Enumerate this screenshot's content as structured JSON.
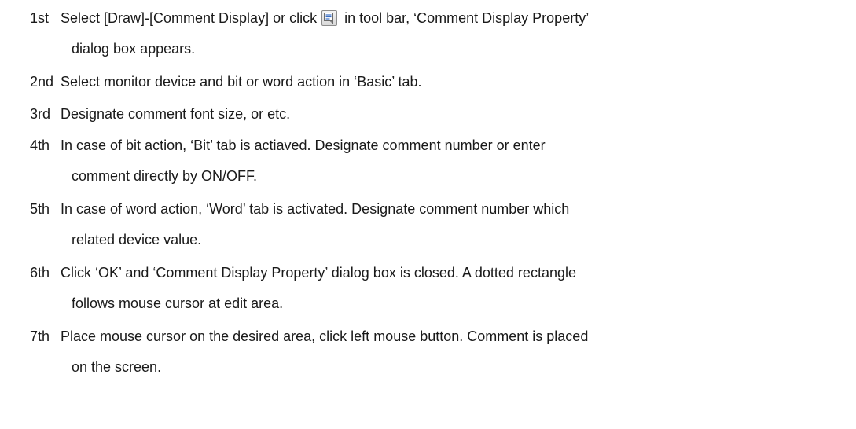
{
  "steps": [
    {
      "number": "1st",
      "text_before_icon": "Select [Draw]-[Comment Display] or click",
      "icon": "comment-display-icon",
      "text_after_icon": "in tool bar, ‘Comment Display Property’",
      "continuation": "dialog box appears."
    },
    {
      "number": "2nd",
      "text": "Select monitor device and bit or word action in ‘Basic’ tab."
    },
    {
      "number": "3rd",
      "text": "Designate comment font size, or etc."
    },
    {
      "number": "4th",
      "text": "In case of bit action, ‘Bit’ tab is actiaved. Designate comment number or enter",
      "continuation": "comment directly by ON/OFF."
    },
    {
      "number": "5th",
      "text": "In case of word action, ‘Word’ tab is activated. Designate comment number which",
      "continuation": "related device value."
    },
    {
      "number": "6th",
      "text": "Click ‘OK’ and ‘Comment Display Property’ dialog box is closed. A dotted rectangle",
      "continuation": "follows mouse cursor at edit area."
    },
    {
      "number": "7th",
      "text": "Place mouse cursor on the desired area, click left mouse button. Comment is placed",
      "continuation": "on the screen."
    }
  ]
}
